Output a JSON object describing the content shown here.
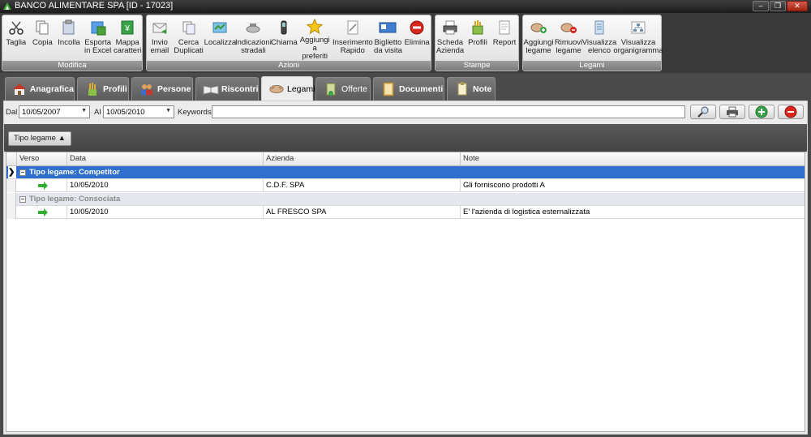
{
  "window": {
    "title": "BANCO ALIMENTARE SPA [ID - 17023]",
    "controls": [
      "minimize",
      "maximize",
      "close"
    ]
  },
  "ribbon": {
    "groups": [
      {
        "label": "Modifica",
        "items": [
          {
            "l1": "Taglia",
            "l2": "",
            "icon": "scissors-icon"
          },
          {
            "l1": "Copia",
            "l2": "",
            "icon": "copy-icon"
          },
          {
            "l1": "Incolla",
            "l2": "",
            "icon": "paste-icon"
          },
          {
            "l1": "Esporta",
            "l2": "in Excel",
            "icon": "excel-export-icon"
          },
          {
            "l1": "Mappa",
            "l2": "caratteri",
            "icon": "charmap-icon"
          }
        ]
      },
      {
        "label": "Azioni",
        "items": [
          {
            "l1": "Invio",
            "l2": "email",
            "icon": "email-icon"
          },
          {
            "l1": "Cerca",
            "l2": "Duplicati",
            "icon": "duplicates-icon"
          },
          {
            "l1": "Localizza",
            "l2": "",
            "icon": "map-icon"
          },
          {
            "l1": "Indicazioni",
            "l2": "stradali",
            "icon": "directions-icon"
          },
          {
            "l1": "Chiama",
            "l2": "",
            "icon": "phone-icon"
          },
          {
            "l1": "Aggiungi a",
            "l2": "preferiti",
            "icon": "star-icon"
          },
          {
            "l1": "Inserimento",
            "l2": "Rapido",
            "icon": "quick-insert-icon"
          },
          {
            "l1": "Biglietto",
            "l2": "da visita",
            "icon": "business-card-icon"
          },
          {
            "l1": "Elimina",
            "l2": "",
            "icon": "delete-icon"
          }
        ]
      },
      {
        "label": "Stampe",
        "items": [
          {
            "l1": "Scheda",
            "l2": "Azienda",
            "icon": "printer-icon"
          },
          {
            "l1": "Profili",
            "l2": "",
            "icon": "profiles-icon"
          },
          {
            "l1": "Report",
            "l2": "",
            "icon": "report-icon"
          }
        ]
      },
      {
        "label": "Legami",
        "items": [
          {
            "l1": "Aggiungi",
            "l2": "legame",
            "icon": "add-link-icon"
          },
          {
            "l1": "Rimuovi",
            "l2": "legame",
            "icon": "remove-link-icon"
          },
          {
            "l1": "Visualizza",
            "l2": "elenco",
            "icon": "list-icon"
          },
          {
            "l1": "Visualizza",
            "l2": "organigramma",
            "icon": "orgchart-icon"
          }
        ]
      }
    ]
  },
  "tabs": [
    {
      "label": "Anagrafica",
      "icon": "house-icon"
    },
    {
      "label": "Profili",
      "icon": "pencils-icon"
    },
    {
      "label": "Persone",
      "icon": "people-icon"
    },
    {
      "label": "Riscontri",
      "icon": "book-icon"
    },
    {
      "label": "Legami",
      "icon": "handshake-icon"
    },
    {
      "label": "Offerte",
      "icon": "offer-icon"
    },
    {
      "label": "Documenti",
      "icon": "documents-icon"
    },
    {
      "label": "Note",
      "icon": "note-icon"
    }
  ],
  "active_tab": "Legami",
  "filter": {
    "dal_label": "Dal",
    "dal_value": "10/05/2007",
    "al_label": "Al",
    "al_value": "10/05/2010",
    "keywords_label": "Keywords",
    "keywords_value": ""
  },
  "grouping": {
    "chip": "Tipo legame ▲"
  },
  "grid": {
    "columns": [
      "Verso",
      "Data",
      "Azienda",
      "Note"
    ],
    "groups": [
      {
        "header": "Tipo legame: Competitor",
        "selected": true,
        "rows": [
          {
            "data": "10/05/2010",
            "azienda": "C.D.F. SPA",
            "note": "Gli forniscono prodotti A"
          }
        ]
      },
      {
        "header": "Tipo legame: Consociata",
        "selected": false,
        "rows": [
          {
            "data": "10/05/2010",
            "azienda": "AL FRESCO SPA",
            "note": "E' l'azienda di logistica esternalizzata"
          }
        ]
      }
    ]
  },
  "colors": {
    "selection": "#2e6fd0",
    "arrow_green": "#2fae2f",
    "delete_red": "#d9261c"
  }
}
